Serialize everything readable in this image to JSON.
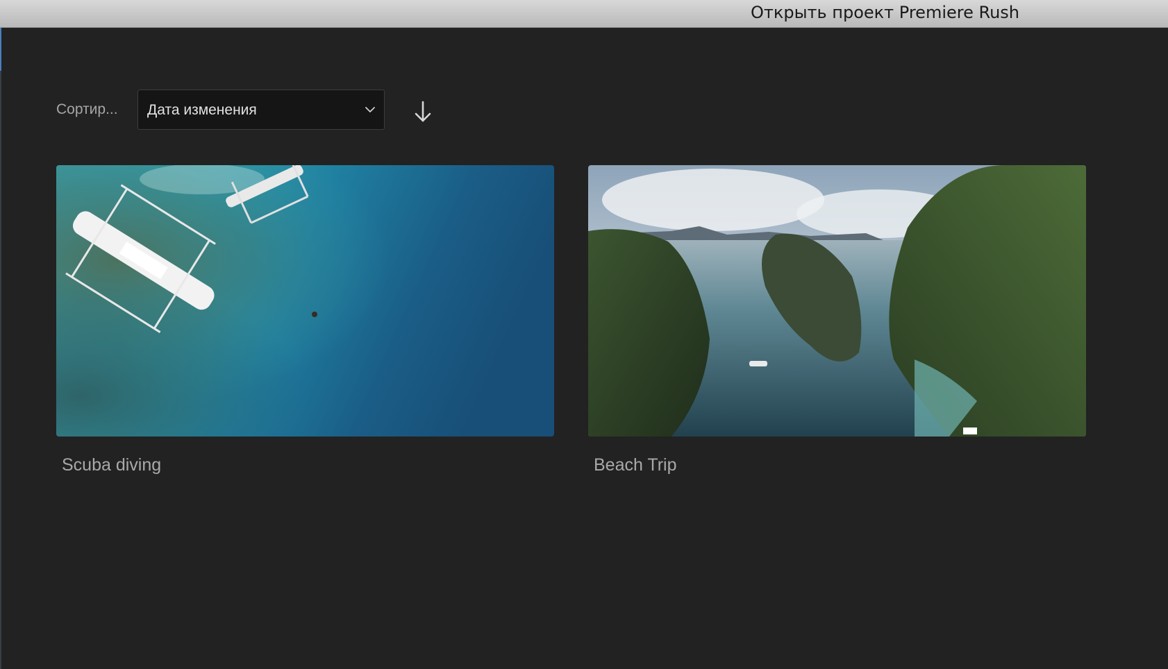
{
  "window": {
    "title": "Открыть проект Premiere Rush"
  },
  "toolbar": {
    "sort_label": "Сортир...",
    "sort_selected": "Дата изменения",
    "sort_direction": "descending",
    "dropdown_icon": "chevron-down-icon",
    "direction_icon": "arrow-down-icon"
  },
  "projects": [
    {
      "name": "Scuba diving",
      "thumbnail": "aerial ocean with outrigger boats"
    },
    {
      "name": "Beach Trip",
      "thumbnail": "aerial lagoon between green cliffs"
    }
  ],
  "colors": {
    "background": "#222222",
    "dropdown_bg": "#151515",
    "text_muted": "#a9a9a9",
    "title_bar": "#c8c8c8"
  }
}
